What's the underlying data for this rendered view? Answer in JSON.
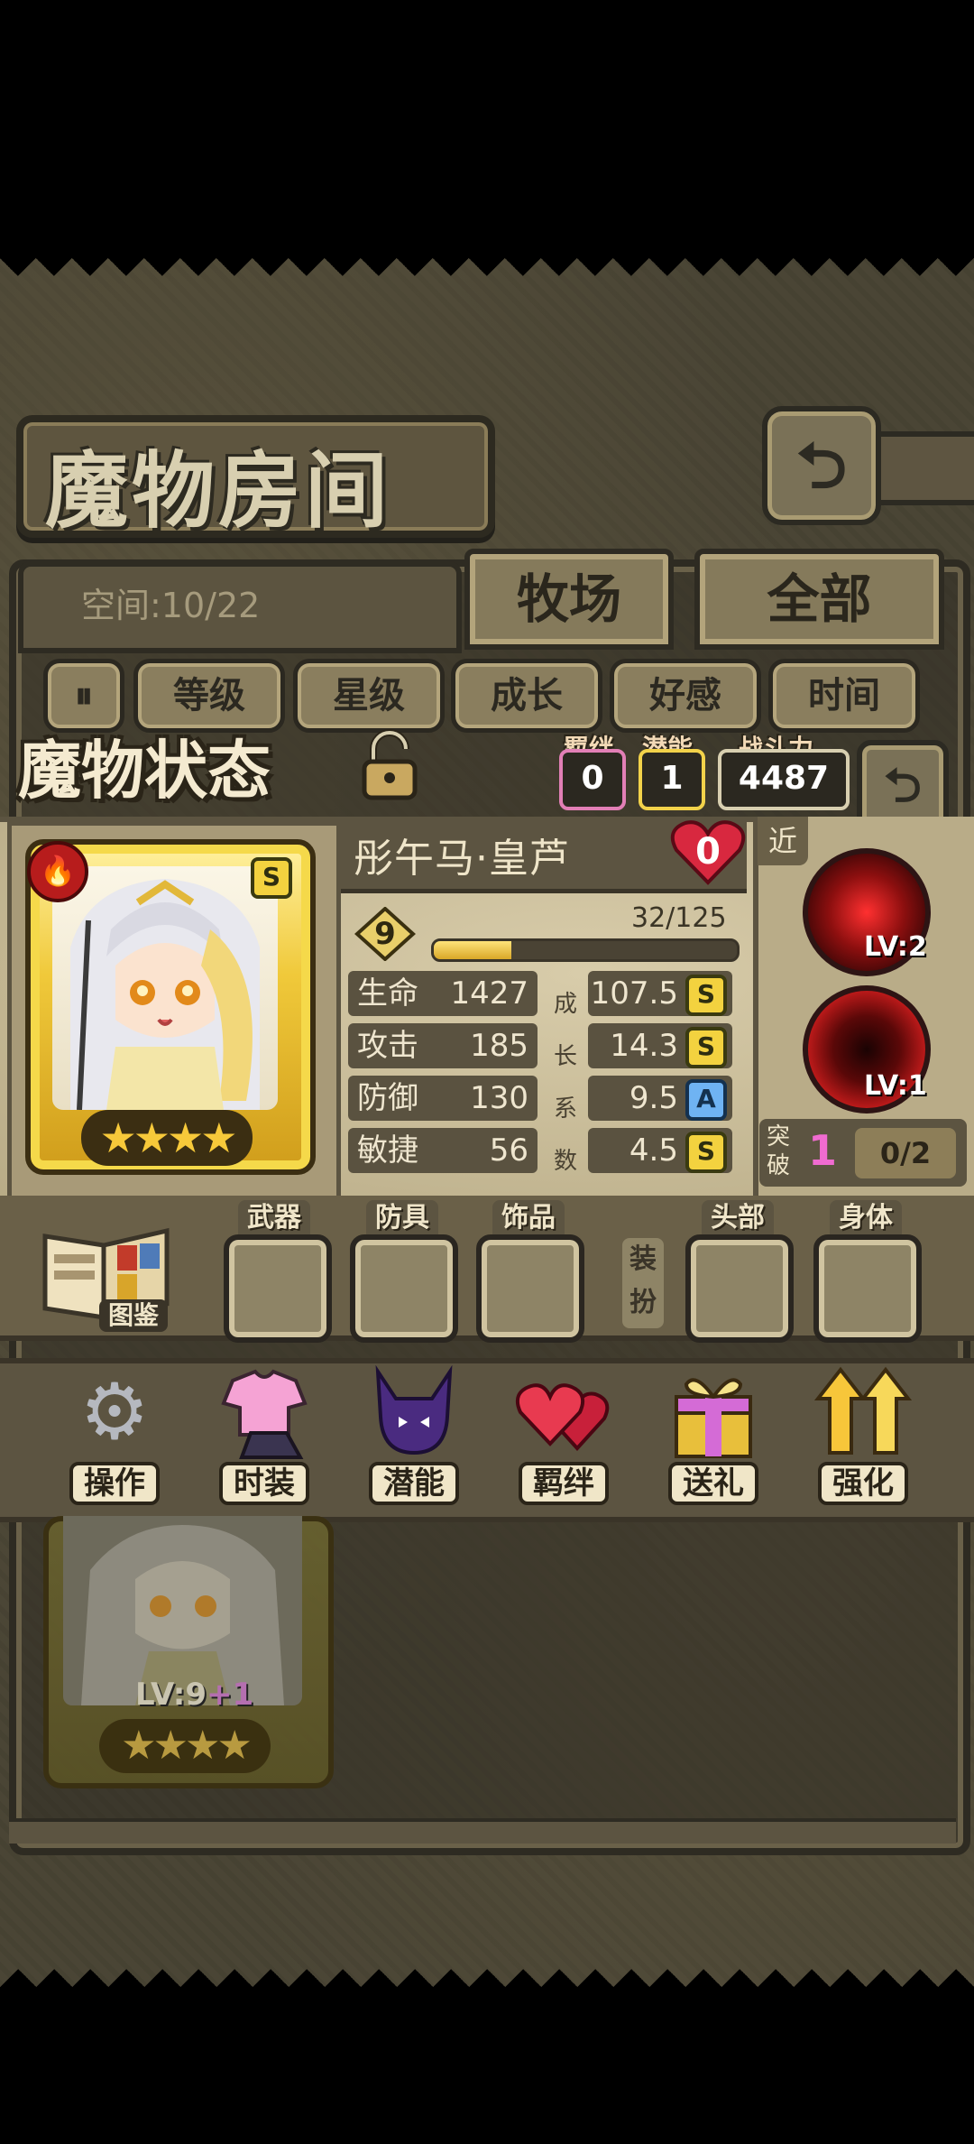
{
  "header": {
    "title": "魔物房间",
    "back_icon": "return-arrow-icon"
  },
  "room": {
    "space_label": "空间:10/22",
    "tabs": [
      {
        "label": "牧场",
        "active": true
      },
      {
        "label": "全部",
        "active": false
      }
    ],
    "filters": [
      "等级",
      "星级",
      "成长",
      "好感",
      "时间"
    ],
    "sort_icon": "sort-toggle-icon"
  },
  "status": {
    "title": "魔物状态",
    "lock_icon": "unlocked-padlock-icon",
    "bond_label": "羁绊",
    "bond_value": "0",
    "potential_label": "潜能",
    "potential_value": "1",
    "power_label": "战斗力",
    "power_value": "4487"
  },
  "monster": {
    "name": "彤午马·皇芦",
    "heart_value": "0",
    "element_icon": "fire-icon",
    "rarity": "S",
    "stars": "★★★★",
    "level": "9",
    "exp_text": "32/125",
    "exp_ratio": 0.256,
    "stats": [
      {
        "label": "生命",
        "value": "1427",
        "growth": "107.5",
        "rank": "S"
      },
      {
        "label": "攻击",
        "value": "185",
        "growth": "14.3",
        "rank": "S"
      },
      {
        "label": "防御",
        "value": "130",
        "growth": "9.5",
        "rank": "A"
      },
      {
        "label": "敏捷",
        "value": "56",
        "growth": "4.5",
        "rank": "S"
      }
    ],
    "growth_vertical": [
      "成",
      "长",
      "系",
      "数"
    ]
  },
  "skills": {
    "range_tag": "近",
    "items": [
      {
        "level": "LV:2"
      },
      {
        "level": "LV:1"
      }
    ],
    "breakthrough_label": "突破",
    "breakthrough_count": "1",
    "breakthrough_progress": "0/2"
  },
  "equipment": {
    "codex_label": "图鉴",
    "slots": [
      "武器",
      "防具",
      "饰品",
      "头部",
      "身体"
    ],
    "dress_label": "装扮"
  },
  "actions": [
    {
      "label": "操作",
      "icon": "gear-icon"
    },
    {
      "label": "时装",
      "icon": "outfit-icon"
    },
    {
      "label": "潜能",
      "icon": "demon-icon"
    },
    {
      "label": "羁绊",
      "icon": "hearts-icon"
    },
    {
      "label": "送礼",
      "icon": "gift-icon"
    },
    {
      "label": "强化",
      "icon": "upgrade-arrows-icon"
    }
  ],
  "ghost_card": {
    "level": "LV:9",
    "bonus": "+1",
    "stars": "★★★★"
  }
}
